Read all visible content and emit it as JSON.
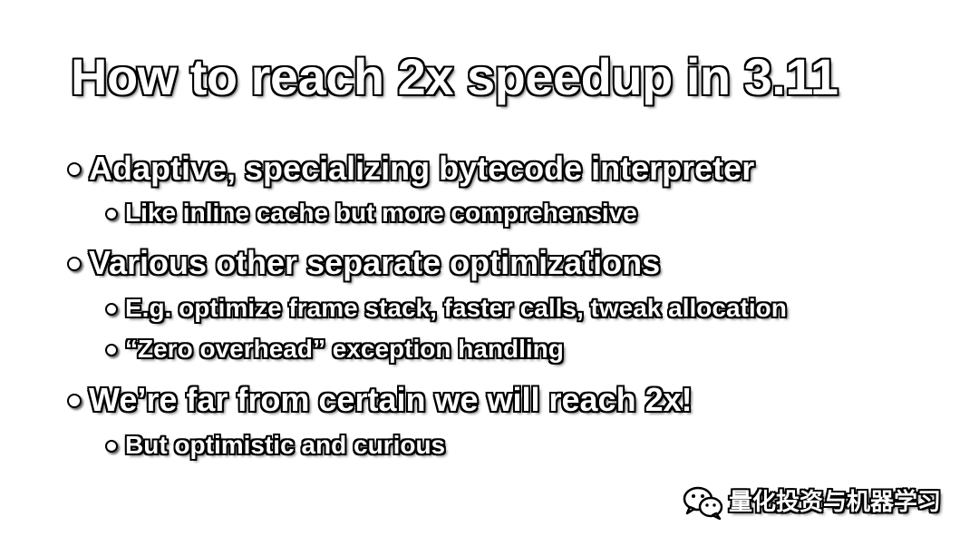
{
  "slide": {
    "title": "How to reach 2x speedup in 3.11",
    "bullets": [
      {
        "text": "Adaptive, specializing bytecode interpreter",
        "level": 1
      },
      {
        "text": "Like inline cache but more comprehensive",
        "level": 2
      },
      {
        "text": "Various other separate optimizations",
        "level": 1
      },
      {
        "text": "E.g. optimize frame stack, faster calls, tweak allocation",
        "level": 2
      },
      {
        "text": "“Zero overhead” exception handling",
        "level": 2
      },
      {
        "text": "We’re far from certain we will reach 2x!",
        "level": 1
      },
      {
        "text": "But optimistic and curious",
        "level": 2
      }
    ]
  },
  "watermark": {
    "icon": "wechat-icon",
    "text": "量化投资与机器学习"
  },
  "colors": {
    "background": "#ffffff",
    "text_fill": "#ffffff",
    "text_outline": "#000000"
  }
}
